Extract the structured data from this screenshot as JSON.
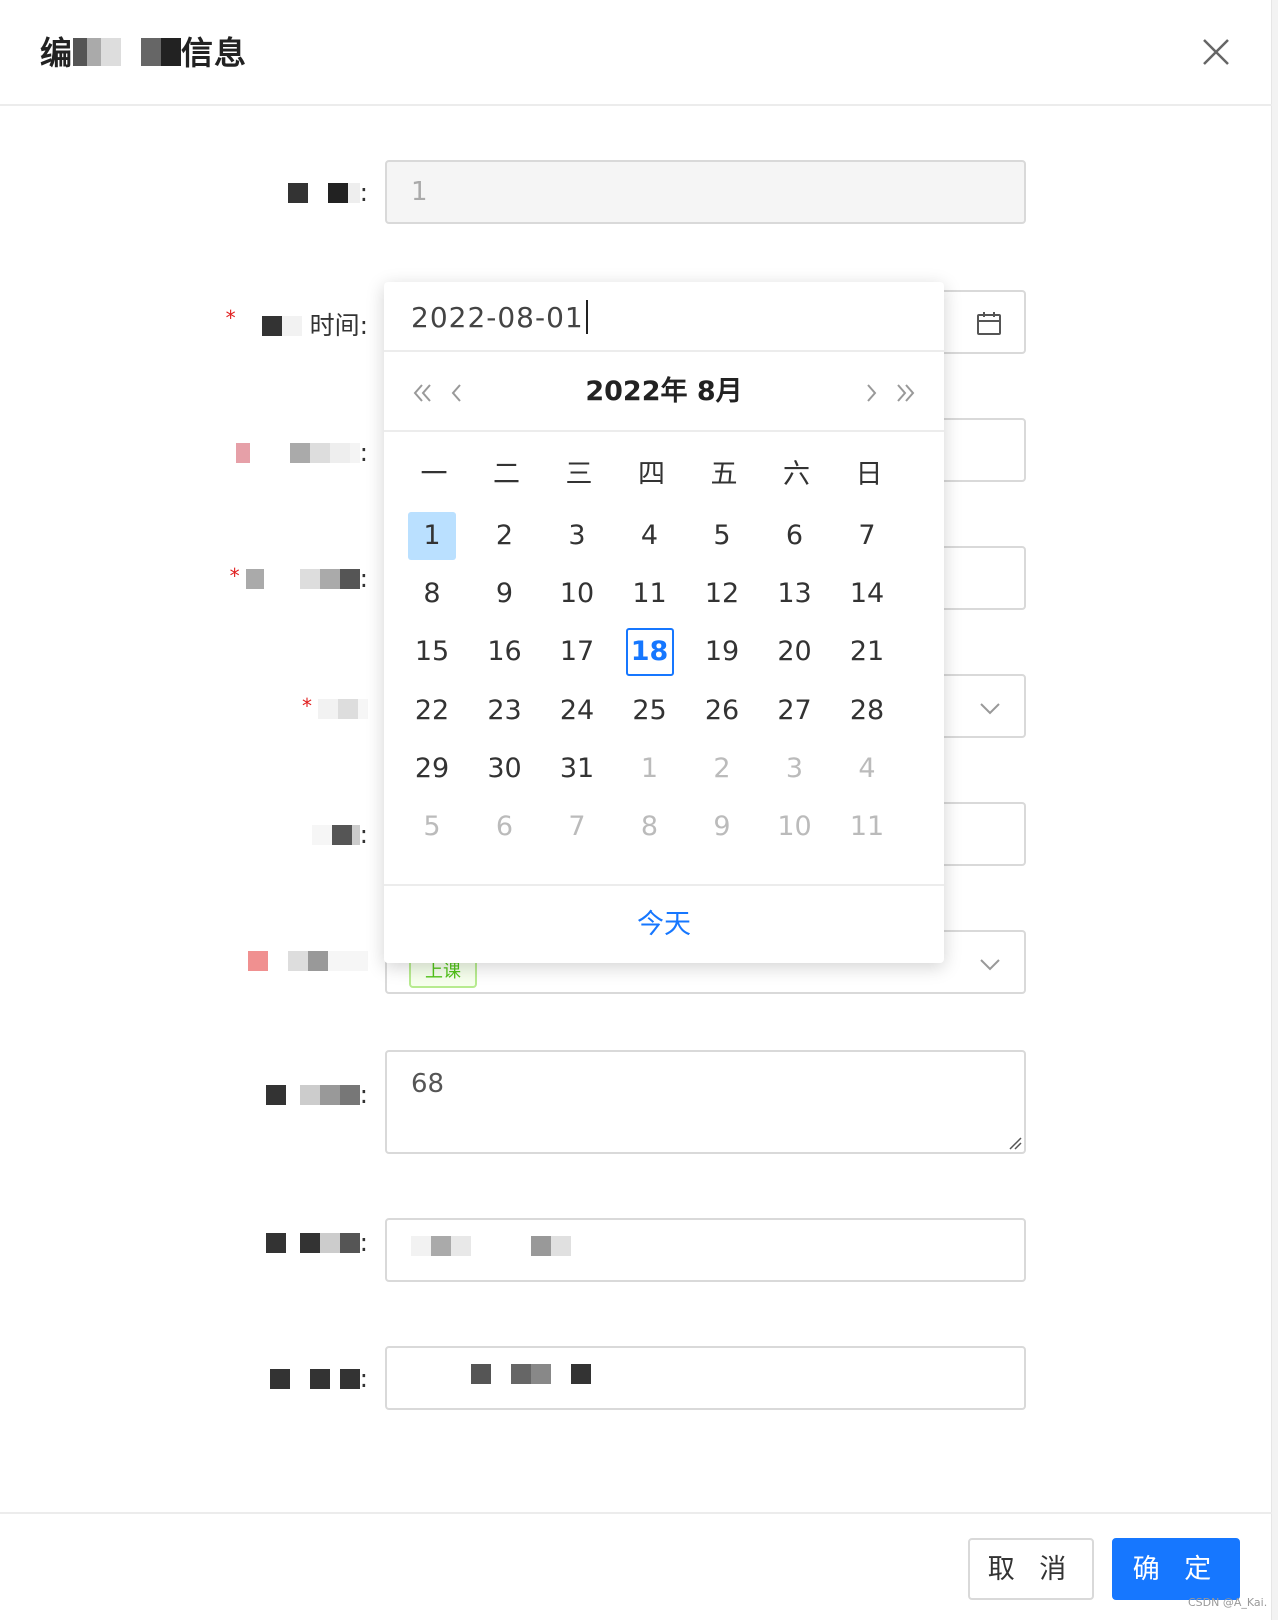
{
  "modal": {
    "title_prefix": "编",
    "title_suffix": "信息"
  },
  "form": {
    "id_value": "1",
    "time_label": "时间:",
    "notes_value": "68",
    "status_tag": "上课"
  },
  "date_picker": {
    "input_value": "2022-08-01",
    "title": "2022年 8月",
    "weekdays": [
      "一",
      "二",
      "三",
      "四",
      "五",
      "六",
      "日"
    ],
    "days": [
      [
        "1",
        "2",
        "3",
        "4",
        "5",
        "6",
        "7"
      ],
      [
        "8",
        "9",
        "10",
        "11",
        "12",
        "13",
        "14"
      ],
      [
        "15",
        "16",
        "17",
        "18",
        "19",
        "20",
        "21"
      ],
      [
        "22",
        "23",
        "24",
        "25",
        "26",
        "27",
        "28"
      ],
      [
        "29",
        "30",
        "31",
        "1",
        "2",
        "3",
        "4"
      ],
      [
        "5",
        "6",
        "7",
        "8",
        "9",
        "10",
        "11"
      ]
    ],
    "selected_date": "2022-08-01",
    "today_date": "2022-08-18",
    "today_button": "今天"
  },
  "footer": {
    "cancel_label": "取 消",
    "ok_label": "确 定"
  },
  "watermark": "CSDN @A_Kai.",
  "colors": {
    "primary": "#1677ff",
    "selected_bg": "#bae0ff",
    "required": "#e02020",
    "tag_green": "#52c41a"
  },
  "icons": {
    "close": "close-icon",
    "calendar": "calendar-icon",
    "chevron_down": "chevron-down-icon",
    "double_left": "double-chevron-left-icon",
    "left": "chevron-left-icon",
    "right": "chevron-right-icon",
    "double_right": "double-chevron-right-icon"
  }
}
